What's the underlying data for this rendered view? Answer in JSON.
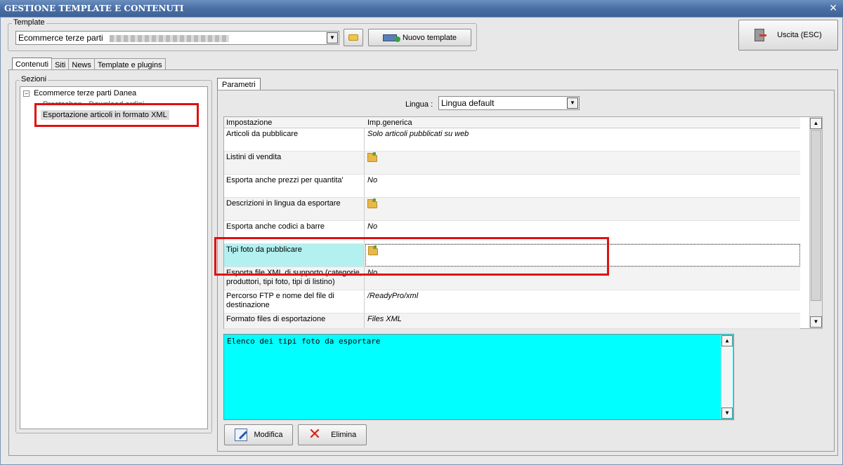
{
  "window": {
    "title": "GESTIONE TEMPLATE E CONTENUTI",
    "close_glyph": "✕"
  },
  "template": {
    "group_label": "Template",
    "selected": "Ecommerce terze parti",
    "new_button": "Nuovo template"
  },
  "exit_button": "Uscita (ESC)",
  "tabs": [
    "Contenuti",
    "Siti",
    "News",
    "Template e plugins"
  ],
  "sections": {
    "group_label": "Sezioni",
    "root": "Ecommerce terze parti Danea",
    "children": [
      "Prestashop - Download ordini",
      "Esportazione articoli in formato XML"
    ]
  },
  "params": {
    "tab": "Parametri",
    "lingua_label": "Lingua :",
    "lingua_value": "Lingua default",
    "headers": [
      "Impostazione",
      "Imp.generica"
    ],
    "rows": [
      {
        "label": "Articoli da pubblicare",
        "value": "Solo articoli pubblicati su web"
      },
      {
        "label": "Listini di vendita",
        "value": "",
        "icon": "folder-icon"
      },
      {
        "label": "Esporta anche prezzi per quantita'",
        "value": "No"
      },
      {
        "label": "Descrizioni in lingua da esportare",
        "value": "",
        "icon": "folder-icon"
      },
      {
        "label": "Esporta anche codici a barre",
        "value": "No"
      },
      {
        "label": "Tipi foto da pubblicare",
        "value": "",
        "icon": "folder-icon"
      },
      {
        "label": "Esporta file XML di supporto (categorie, produttori, tipi foto, tipi di listino)",
        "value": "No"
      },
      {
        "label": "Percorso FTP e nome del file di destinazione",
        "value": "/ReadyPro/xml"
      },
      {
        "label": "Formato files di esportazione",
        "value": "Files XML"
      }
    ],
    "description": "Elenco dei tipi foto da esportare",
    "modifica_button": "Modifica",
    "elimina_button": "Elimina"
  },
  "colors": {
    "titlebar": "#4a6fa5",
    "highlight": "#00ffff",
    "annotation": "#e01010"
  }
}
